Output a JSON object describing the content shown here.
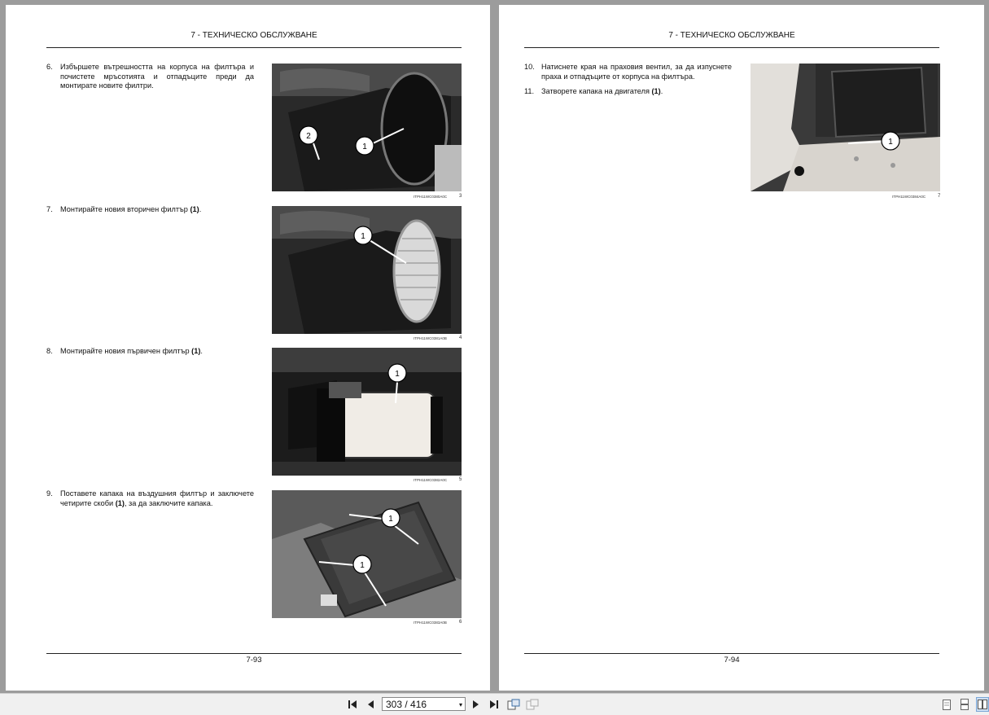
{
  "viewer": {
    "left_page": {
      "header": "7 - ТЕХНИЧЕСКО ОБСЛУЖВАНЕ",
      "page_number": "7-93",
      "steps": [
        {
          "num": "6.",
          "text": "Избършете вътрешността на корпуса на филтъра и почистете мръсотията и отпадъците преди да монтирате новите филтри.",
          "fig_code": "ITPH11WC0380A0C",
          "fig_num": "3",
          "callouts": [
            "1",
            "2"
          ]
        },
        {
          "num": "7.",
          "text_pre": "Монтирайте новия вторичен филтър ",
          "bold": "(1)",
          "text_post": ".",
          "fig_code": "ITPH11WC0381A0B",
          "fig_num": "4",
          "callouts": [
            "1"
          ]
        },
        {
          "num": "8.",
          "text_pre": "Монтирайте новия първичен филтър ",
          "bold": "(1)",
          "text_post": ".",
          "fig_code": "ITPH11WC0382A0C",
          "fig_num": "5",
          "callouts": [
            "1"
          ]
        },
        {
          "num": "9.",
          "text_pre": "Поставете капака на въздушния филтър и заключете четирите скоби ",
          "bold": "(1)",
          "text_post": ", за да заключите капака.",
          "fig_code": "ITPH11WC0383A0B",
          "fig_num": "6",
          "callouts": [
            "1",
            "1"
          ]
        }
      ]
    },
    "right_page": {
      "header": "7 - ТЕХНИЧЕСКО ОБСЛУЖВАНЕ",
      "page_number": "7-94",
      "steps": [
        {
          "num": "10.",
          "text": "Натиснете края на праховия вентил, за да изпуснете праха и отпадъците от корпуса на филтъра."
        },
        {
          "num": "11.",
          "text_pre": "Затворете капака на двигателя ",
          "bold": "(1)",
          "text_post": "."
        }
      ],
      "figure": {
        "fig_code": "ITPH11WC0384A0C",
        "fig_num": "7",
        "callouts": [
          "1"
        ]
      }
    }
  },
  "toolbar": {
    "page_field": "303 / 416",
    "icons": [
      "first-page-icon",
      "prev-page-icon",
      "dropdown-icon",
      "next-page-icon",
      "last-page-icon",
      "rotate-view-icon",
      "fit-view-icon",
      "single-page-view-icon",
      "continuous-view-icon",
      "two-page-view-icon"
    ]
  }
}
